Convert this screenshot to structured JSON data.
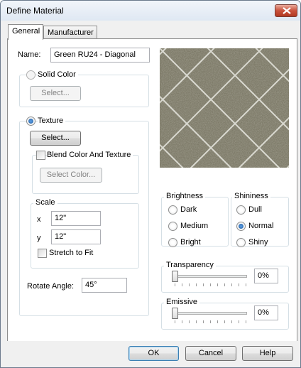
{
  "window": {
    "title": "Define Material"
  },
  "tabs": [
    {
      "label": "General",
      "active": true
    },
    {
      "label": "Manufacturer",
      "active": false
    }
  ],
  "name": {
    "label": "Name:",
    "value": "Green RU24 - Diagonal"
  },
  "solid_color": {
    "label": "Solid Color",
    "checked": false,
    "select_label": "Select..."
  },
  "texture": {
    "label": "Texture",
    "checked": true,
    "select_label": "Select...",
    "blend_label": "Blend Color And Texture",
    "blend_checked": false,
    "select_color_label": "Select Color..."
  },
  "scale": {
    "legend": "Scale",
    "x_label": "x",
    "x_value": "12\"",
    "y_label": "y",
    "y_value": "12\"",
    "stretch_label": "Stretch to Fit",
    "stretch_checked": false
  },
  "rotate": {
    "label": "Rotate Angle:",
    "value": "45°"
  },
  "brightness": {
    "legend": "Brightness",
    "options": [
      "Dark",
      "Medium",
      "Bright"
    ],
    "selected": null
  },
  "shininess": {
    "legend": "Shininess",
    "options": [
      "Dull",
      "Normal",
      "Shiny"
    ],
    "selected": "Normal"
  },
  "transparency": {
    "legend": "Transparency",
    "value": "0%",
    "level": 0
  },
  "emissive": {
    "legend": "Emissive",
    "value": "0%",
    "level": 0
  },
  "buttons": {
    "ok": "OK",
    "cancel": "Cancel",
    "help": "Help"
  },
  "colors": {
    "accent": "#1c5597",
    "close": "#c9513c",
    "tile": "#7d7a68",
    "grout": "#e2e2da"
  }
}
